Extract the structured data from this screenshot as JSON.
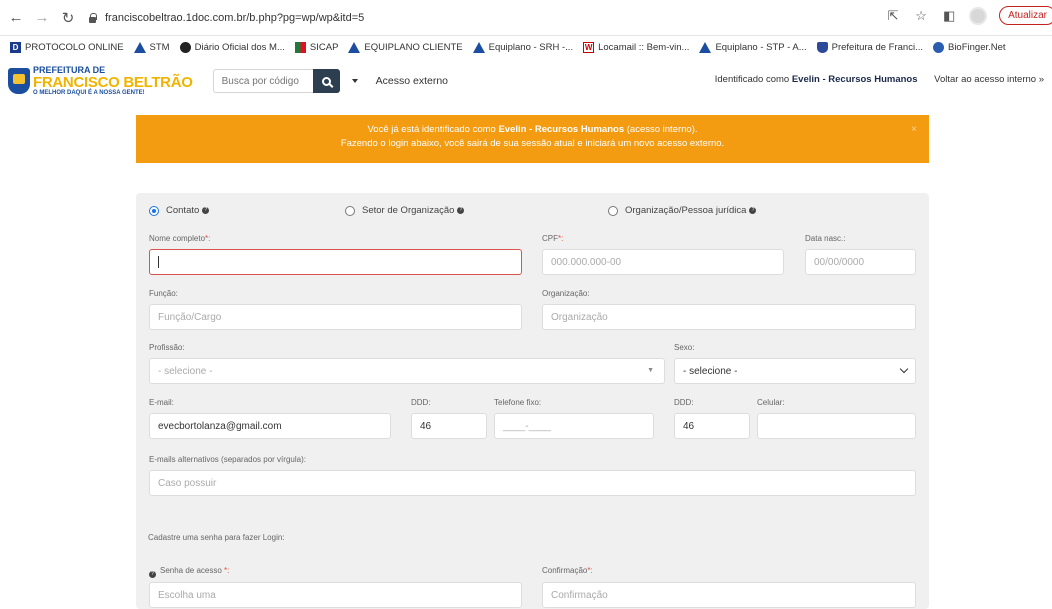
{
  "browser": {
    "url": "franciscobeltrao.1doc.com.br/b.php?pg=wp/wp&itd=5",
    "update_label": "Atualizar",
    "bookmarks": [
      {
        "label": "PROTOCOLO ONLINE",
        "icon": "doc-d-icon"
      },
      {
        "label": "STM",
        "icon": "triangle-icon"
      },
      {
        "label": "Diário Oficial dos M...",
        "icon": "circle-icon"
      },
      {
        "label": "SICAP",
        "icon": "sicap-icon"
      },
      {
        "label": "EQUIPLANO CLIENTE",
        "icon": "triangle-icon"
      },
      {
        "label": "Equiplano - SRH -...",
        "icon": "triangle-icon"
      },
      {
        "label": "Locamail :: Bem-vin...",
        "icon": "w-icon"
      },
      {
        "label": "Equiplano - STP - A...",
        "icon": "triangle-icon"
      },
      {
        "label": "Prefeitura de Franci...",
        "icon": "shield-icon"
      },
      {
        "label": "BioFinger.Net",
        "icon": "fingerprint-icon"
      }
    ]
  },
  "header": {
    "logo": {
      "line1": "PREFEITURA DE",
      "line2": "FRANCISCO BELTRÃO",
      "line3": "O MELHOR DAQUI É A NOSSA GENTE!"
    },
    "search_placeholder": "Busca por código",
    "external_access": "Acesso externo",
    "identified_prefix": "Identificado como",
    "identified_user": "Evelin - Recursos Humanos",
    "back_link": "Voltar ao acesso interno »"
  },
  "alert": {
    "line1_pre": "Você já está identificado como ",
    "line1_user": "Evelin - Recursos Humanos",
    "line1_post": " (acesso interno).",
    "line2": "Fazendo o login abaixo, você sairá de sua sessão atual e iniciará um novo acesso externo.",
    "close": "×"
  },
  "form": {
    "radios": [
      {
        "label": "Contato",
        "checked": true
      },
      {
        "label": "Setor de Organização",
        "checked": false
      },
      {
        "label": "Organização/Pessoa jurídica",
        "checked": false
      }
    ],
    "nome_label": "Nome completo",
    "cpf_label": "CPF",
    "cpf_placeholder": "000.000.000-00",
    "nasc_label": "Data nasc.:",
    "nasc_placeholder": "00/00/0000",
    "funcao_label": "Função:",
    "funcao_placeholder": "Função/Cargo",
    "org_label": "Organização:",
    "org_placeholder": "Organização",
    "profissao_label": "Profissão:",
    "profissao_value": "- selecione -",
    "sexo_label": "Sexo:",
    "sexo_value": "- selecione -",
    "email_label": "E-mail:",
    "email_value": "evecbortolanza@gmail.com",
    "ddd_label": "DDD:",
    "ddd_value": "46",
    "tel_label": "Telefone fixo:",
    "tel_placeholder": "____-____",
    "ddd2_label": "DDD:",
    "ddd2_value": "46",
    "cel_label": "Celular:",
    "emails_alt_label": "E-mails alternativos (separados por vírgula):",
    "emails_alt_placeholder": "Caso possuir",
    "senha_section": "Cadastre uma senha para fazer Login:",
    "senha_label": "Senha de acesso",
    "senha_placeholder": "Escolha uma",
    "conf_label": "Confirmação",
    "conf_placeholder": "Confirmação",
    "required_mark": "*:",
    "required_mark_space": " *:"
  }
}
